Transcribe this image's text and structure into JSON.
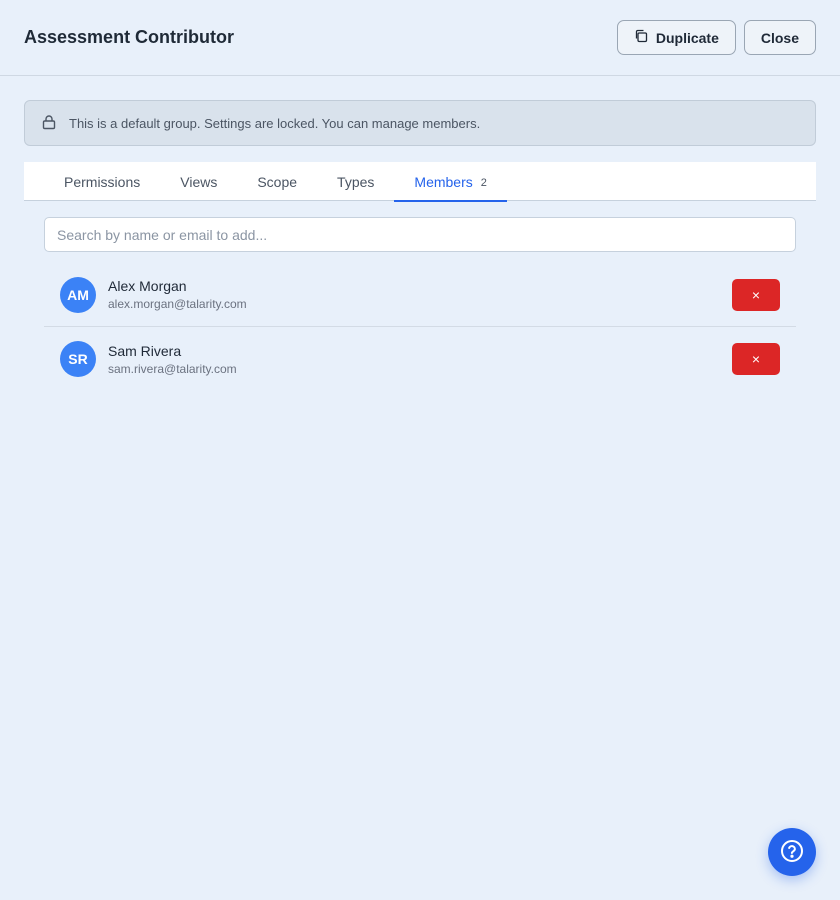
{
  "header": {
    "title": "Assessment Contributor",
    "duplicate_label": "Duplicate",
    "close_label": "Close"
  },
  "notice": {
    "text": "This is a default group. Settings are locked. You can manage members."
  },
  "tabs": [
    {
      "label": "Permissions"
    },
    {
      "label": "Views"
    },
    {
      "label": "Scope"
    },
    {
      "label": "Types"
    },
    {
      "label": "Members",
      "count": "2",
      "active": true
    }
  ],
  "search": {
    "placeholder": "Search by name or email to add..."
  },
  "members": [
    {
      "initials": "AM",
      "name": "Alex Morgan",
      "email": "alex.morgan@talarity.com",
      "remove_label": "×"
    },
    {
      "initials": "SR",
      "name": "Sam Rivera",
      "email": "sam.rivera@talarity.com",
      "remove_label": "×"
    }
  ],
  "icons": {
    "duplicate": "copy-icon",
    "lock": "lock-icon",
    "help": "help-circle-icon"
  },
  "colors": {
    "accent": "#2563eb",
    "danger": "#dc2626",
    "avatar": "#3b82f6"
  }
}
